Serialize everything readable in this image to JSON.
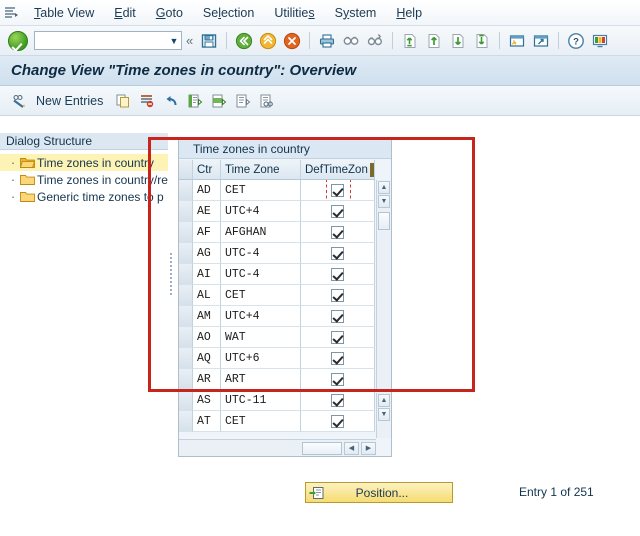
{
  "menubar": {
    "system_icon": "sap-menu-icon",
    "items": [
      {
        "label": "Table View",
        "accel": "T",
        "name": "menu-table-view"
      },
      {
        "label": "Edit",
        "accel": "E",
        "name": "menu-edit"
      },
      {
        "label": "Goto",
        "accel": "G",
        "name": "menu-goto"
      },
      {
        "label": "Selection",
        "accel": "l",
        "name": "menu-selection"
      },
      {
        "label": "Utilities",
        "accel": "s",
        "name": "menu-utilities"
      },
      {
        "label": "System",
        "accel": "y",
        "name": "menu-system"
      },
      {
        "label": "Help",
        "accel": "H",
        "name": "menu-help"
      }
    ]
  },
  "toolbar": {
    "enter_icon": "green-check-enter-icon",
    "command_value": "",
    "command_placeholder": "",
    "dropdown_icon": "chevron-down-icon",
    "collapse_icon": "double-chevron-left-icon",
    "icons": [
      "save-icon",
      "back-icon",
      "exit-icon",
      "cancel-icon",
      "print-icon",
      "find-icon",
      "find-next-icon",
      "first-page-icon",
      "previous-page-icon",
      "next-page-icon",
      "last-page-icon",
      "create-session-icon",
      "create-shortcut-icon",
      "help-icon",
      "customize-local-layout-icon"
    ]
  },
  "title": {
    "text": "Change View \"Time zones in country\": Overview"
  },
  "apptoolbar": {
    "display_change_icon": "display-change-icon",
    "new_entries_label": "New Entries",
    "icons": [
      "copy-as-icon",
      "delete-icon",
      "undo-icon",
      "select-all-icon",
      "select-block-icon",
      "deselect-all-icon",
      "details-icon"
    ]
  },
  "tree": {
    "header": "Dialog Structure",
    "items": [
      {
        "label": "Time zones in country",
        "icon": "folder-open-icon",
        "selected": true
      },
      {
        "label": "Time zones in country/re",
        "icon": "folder-icon",
        "selected": false
      },
      {
        "label": "Generic time zones to p",
        "icon": "folder-icon",
        "selected": false
      }
    ]
  },
  "table": {
    "caption": "Time zones in country",
    "columns": [
      "Ctr",
      "Time Zone",
      "DefTimeZon"
    ],
    "column_config_icon": "column-configuration-icon",
    "rows": [
      {
        "ctr": "AD",
        "tz": "CET",
        "def": true,
        "focused": true
      },
      {
        "ctr": "AE",
        "tz": "UTC+4",
        "def": true,
        "focused": false
      },
      {
        "ctr": "AF",
        "tz": "AFGHAN",
        "def": true,
        "focused": false
      },
      {
        "ctr": "AG",
        "tz": "UTC-4",
        "def": true,
        "focused": false
      },
      {
        "ctr": "AI",
        "tz": "UTC-4",
        "def": true,
        "focused": false
      },
      {
        "ctr": "AL",
        "tz": "CET",
        "def": true,
        "focused": false
      },
      {
        "ctr": "AM",
        "tz": "UTC+4",
        "def": true,
        "focused": false
      },
      {
        "ctr": "AO",
        "tz": "WAT",
        "def": true,
        "focused": false
      },
      {
        "ctr": "AQ",
        "tz": "UTC+6",
        "def": true,
        "focused": false
      },
      {
        "ctr": "AR",
        "tz": "ART",
        "def": true,
        "focused": false
      },
      {
        "ctr": "AS",
        "tz": "UTC-11",
        "def": true,
        "focused": false
      },
      {
        "ctr": "AT",
        "tz": "CET",
        "def": true,
        "focused": false
      }
    ],
    "scroll": {
      "up_icon": "scroll-up-icon",
      "down_icon": "scroll-down-icon",
      "left_icon": "scroll-left-icon",
      "right_icon": "scroll-right-icon"
    }
  },
  "footer": {
    "position_label": "Position...",
    "position_icon": "position-icon",
    "entry_status": "Entry 1 of 251"
  },
  "annotation": {
    "color": "#c9241b",
    "shape": "rectangle-highlight"
  }
}
